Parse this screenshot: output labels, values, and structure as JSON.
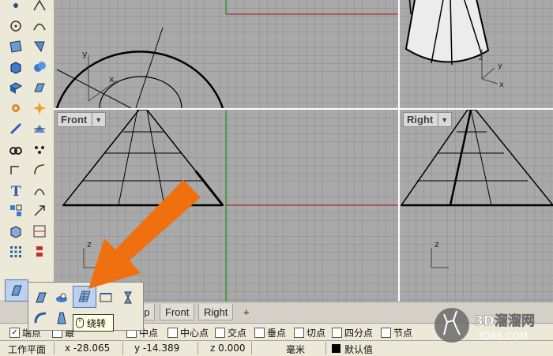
{
  "viewports": {
    "top_left": {
      "label": ""
    },
    "perspective": {
      "label": ""
    },
    "front": {
      "label": "Front"
    },
    "right": {
      "label": "Right"
    }
  },
  "axes": {
    "x": "x",
    "y": "y",
    "z": "z"
  },
  "viewport_tabs": [
    {
      "label": "op"
    },
    {
      "label": "Front"
    },
    {
      "label": "Right"
    },
    {
      "label": "+"
    }
  ],
  "osnap": [
    {
      "label": "端点",
      "checked": true
    },
    {
      "label": "最",
      "checked": false
    },
    {
      "label": "中点",
      "checked": false
    },
    {
      "label": "中心点",
      "checked": false
    },
    {
      "label": "交点",
      "checked": false
    },
    {
      "label": "垂点",
      "checked": false
    },
    {
      "label": "切点",
      "checked": false
    },
    {
      "label": "四分点",
      "checked": false
    },
    {
      "label": "节点",
      "checked": false
    }
  ],
  "status": {
    "cplane": "工作平面",
    "x": "x -28.065",
    "y": "y -14.389",
    "z": "z 0.000",
    "units": "毫米",
    "layer": "默认值"
  },
  "tooltip": {
    "text": "绕转"
  },
  "logo": {
    "main": "3D溜溜网",
    "sub": "3D66.COM"
  },
  "colors": {
    "arrow": "#f07010",
    "x_axis": "#b03030",
    "y_axis": "#30a030",
    "grid_bg": "#a9a9a9"
  }
}
